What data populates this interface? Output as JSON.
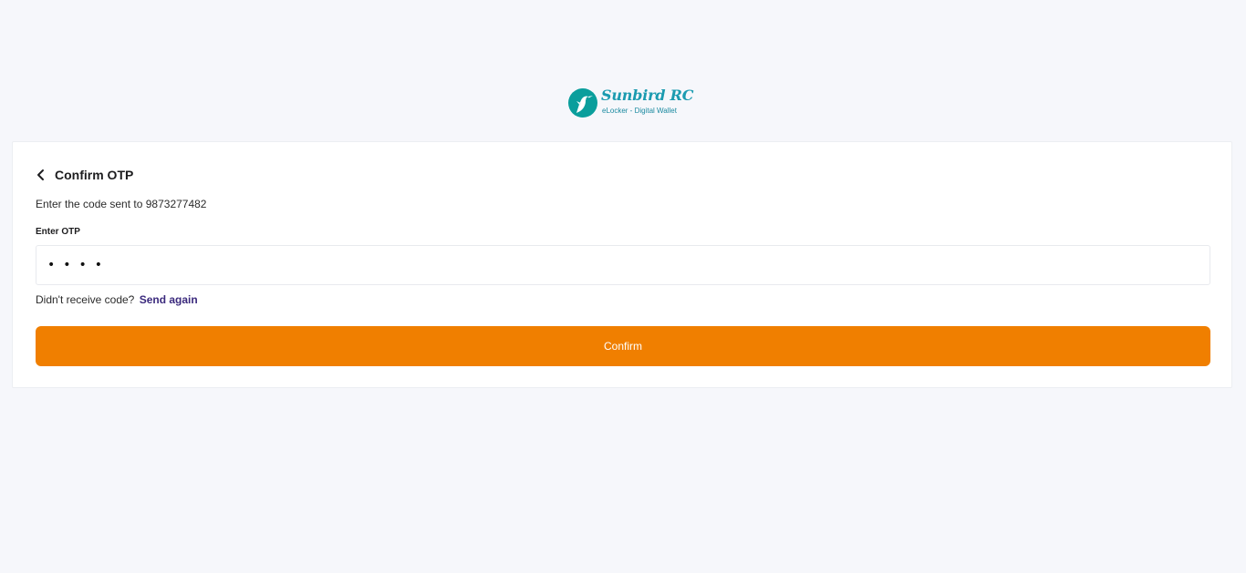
{
  "brand": {
    "name": "Sunbird RC",
    "tagline": "eLocker - Digital Wallet",
    "primary_color": "#0a9e9c"
  },
  "form": {
    "title": "Confirm OTP",
    "subtitle": "Enter the code sent to 9873277482",
    "otp_label": "Enter OTP",
    "otp_value": "••••",
    "resend_prompt": "Didn't receive code?",
    "resend_link": "Send again",
    "confirm_label": "Confirm",
    "accent_color": "#f07f00",
    "link_color": "#3b2a7d"
  },
  "icons": {
    "back": "chevron-left-icon",
    "logo": "hummingbird-logo-icon"
  }
}
